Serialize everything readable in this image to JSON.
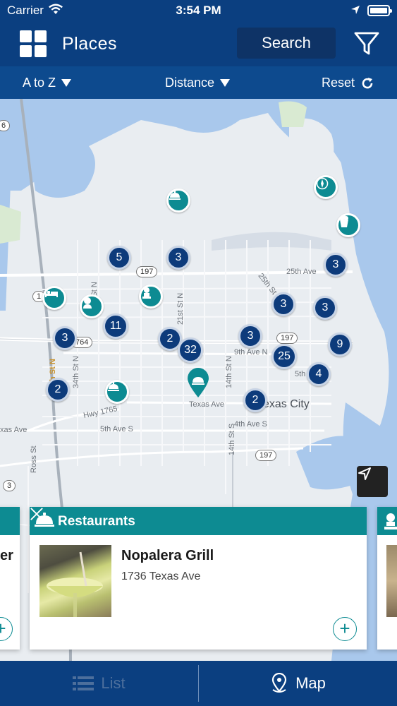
{
  "status_bar": {
    "carrier": "Carrier",
    "time": "3:54 PM"
  },
  "header": {
    "title": "Places",
    "search_label": "Search"
  },
  "sort_bar": {
    "a_to_z": "A to Z",
    "distance": "Distance",
    "reset": "Reset"
  },
  "map": {
    "clusters": [
      "5",
      "3",
      "3",
      "3",
      "3",
      "11",
      "2",
      "32",
      "3",
      "3",
      "25",
      "9",
      "4",
      "2",
      "2"
    ],
    "place_labels": [
      "Texas Ave",
      "25th Ave",
      "9th Ave N",
      "5th",
      "5th Ave S",
      "4th Ave S",
      "Hwy 1765",
      "xas Ave",
      "34th St N",
      "21st St N",
      "14th St N",
      "25th St N",
      "34th St N",
      "Ross St",
      "14th St S",
      "h St N"
    ],
    "city_label": "exas City",
    "road_badges": [
      "197",
      "197",
      "764",
      "197",
      "3",
      "6",
      "1"
    ]
  },
  "cards": [
    {
      "category": "er",
      "partial": true
    },
    {
      "category": "Restaurants",
      "name": "Nopalera Grill",
      "address": "1736 Texas Ave"
    },
    {
      "category": "",
      "partial": true
    }
  ],
  "tabbar": {
    "list_label": "List",
    "map_label": "Map"
  },
  "colors": {
    "header_blue": "#0b3f80",
    "teal": "#0d8b92",
    "cluster_blue": "#0d3b7b"
  }
}
